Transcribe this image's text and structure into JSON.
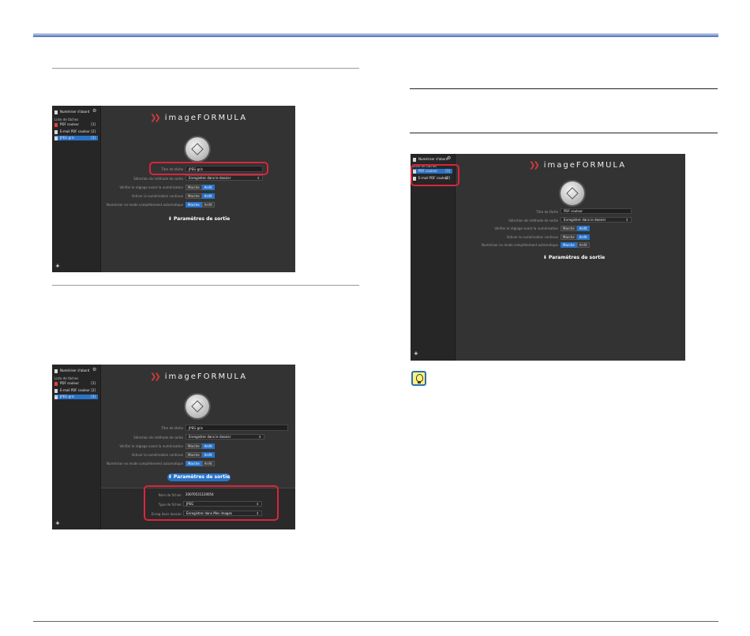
{
  "shot_left_top": {
    "sidebar": {
      "home": "Numériser d'abord",
      "list_header": "Liste de tâches",
      "items": [
        {
          "label": "PDF couleur",
          "count": "[1]"
        },
        {
          "label": "E-mail PDF couleur",
          "count": "[2]"
        },
        {
          "label": "JPEG gris",
          "count": "[3]"
        }
      ]
    },
    "logo": "imageFORMULA",
    "fields": [
      {
        "label": "Titre de tâche",
        "value": "JPEG gris"
      },
      {
        "label": "Sélection de méthode de sortie",
        "value": "Enregistrer dans le dossier"
      }
    ],
    "toggles": [
      {
        "label": "Vérifier le réglage avant la numérisation",
        "on": "Marche",
        "off": "Arrêt"
      },
      {
        "label": "Activer la numérisation continue",
        "on": "Marche",
        "off": "Arrêt"
      },
      {
        "label": "Numériser en mode complètement automatique",
        "on": "Marche",
        "off": "Arrêt"
      }
    ],
    "output_button": "Paramètres de sortie"
  },
  "shot_left_bottom": {
    "sidebar": {
      "home": "Numériser d'abord",
      "list_header": "Liste de tâches",
      "items": [
        {
          "label": "PDF couleur",
          "count": "[1]"
        },
        {
          "label": "E-mail PDF couleur",
          "count": "[2]"
        },
        {
          "label": "JPEG gris",
          "count": "[3]"
        }
      ]
    },
    "logo": "imageFORMULA",
    "fields": [
      {
        "label": "Titre de tâche",
        "value": "JPEG gris"
      },
      {
        "label": "Sélection de méthode de sortie",
        "value": "Enregistrer dans le dossier"
      }
    ],
    "toggles": [
      {
        "label": "Vérifier le réglage avant la numérisation",
        "on": "Marche",
        "off": "Arrêt"
      },
      {
        "label": "Activer la numérisation continue",
        "on": "Marche",
        "off": "Arrêt"
      },
      {
        "label": "Numériser en mode complètement automatique",
        "on": "Marche",
        "off": "Arrêt"
      }
    ],
    "output_button": "Paramètres de sortie",
    "output_panel": [
      {
        "label": "Nom de fichier",
        "value": "20070531120054"
      },
      {
        "label": "Type de fichier",
        "value": "JPEG"
      },
      {
        "label": "Enreg dans dossier",
        "value": "Enregistrer dans Mes images"
      }
    ]
  },
  "shot_right": {
    "sidebar": {
      "home": "Numériser d'abord",
      "list_header": "Liste de tâches",
      "items": [
        {
          "label": "PDF couleur",
          "count": "[1]"
        },
        {
          "label": "E-mail PDF couleur",
          "count": "[2]"
        }
      ]
    },
    "logo": "imageFORMULA",
    "fields": [
      {
        "label": "Titre de tâche",
        "value": "PDF couleur"
      },
      {
        "label": "Sélection de méthode de sortie",
        "value": "Enregistrer dans le dossier"
      }
    ],
    "toggles": [
      {
        "label": "Vérifier le réglage avant la numérisation",
        "on": "Marche",
        "off": "Arrêt"
      },
      {
        "label": "Activer la numérisation continue",
        "on": "Marche",
        "off": "Arrêt"
      },
      {
        "label": "Numériser en mode complètement automatique",
        "on": "Marche",
        "off": "Arrêt"
      }
    ],
    "output_button": "Paramètres de sortie"
  },
  "colors": {
    "header_bar": "#4a6db5",
    "highlight": "#d7263d",
    "selection": "#2a73c8",
    "app_bg": "#333333"
  },
  "icons": [
    "document-icon",
    "gear-icon",
    "plus-icon",
    "scan-button-icon",
    "arrow-down-icon",
    "lightbulb-hint-icon"
  ]
}
